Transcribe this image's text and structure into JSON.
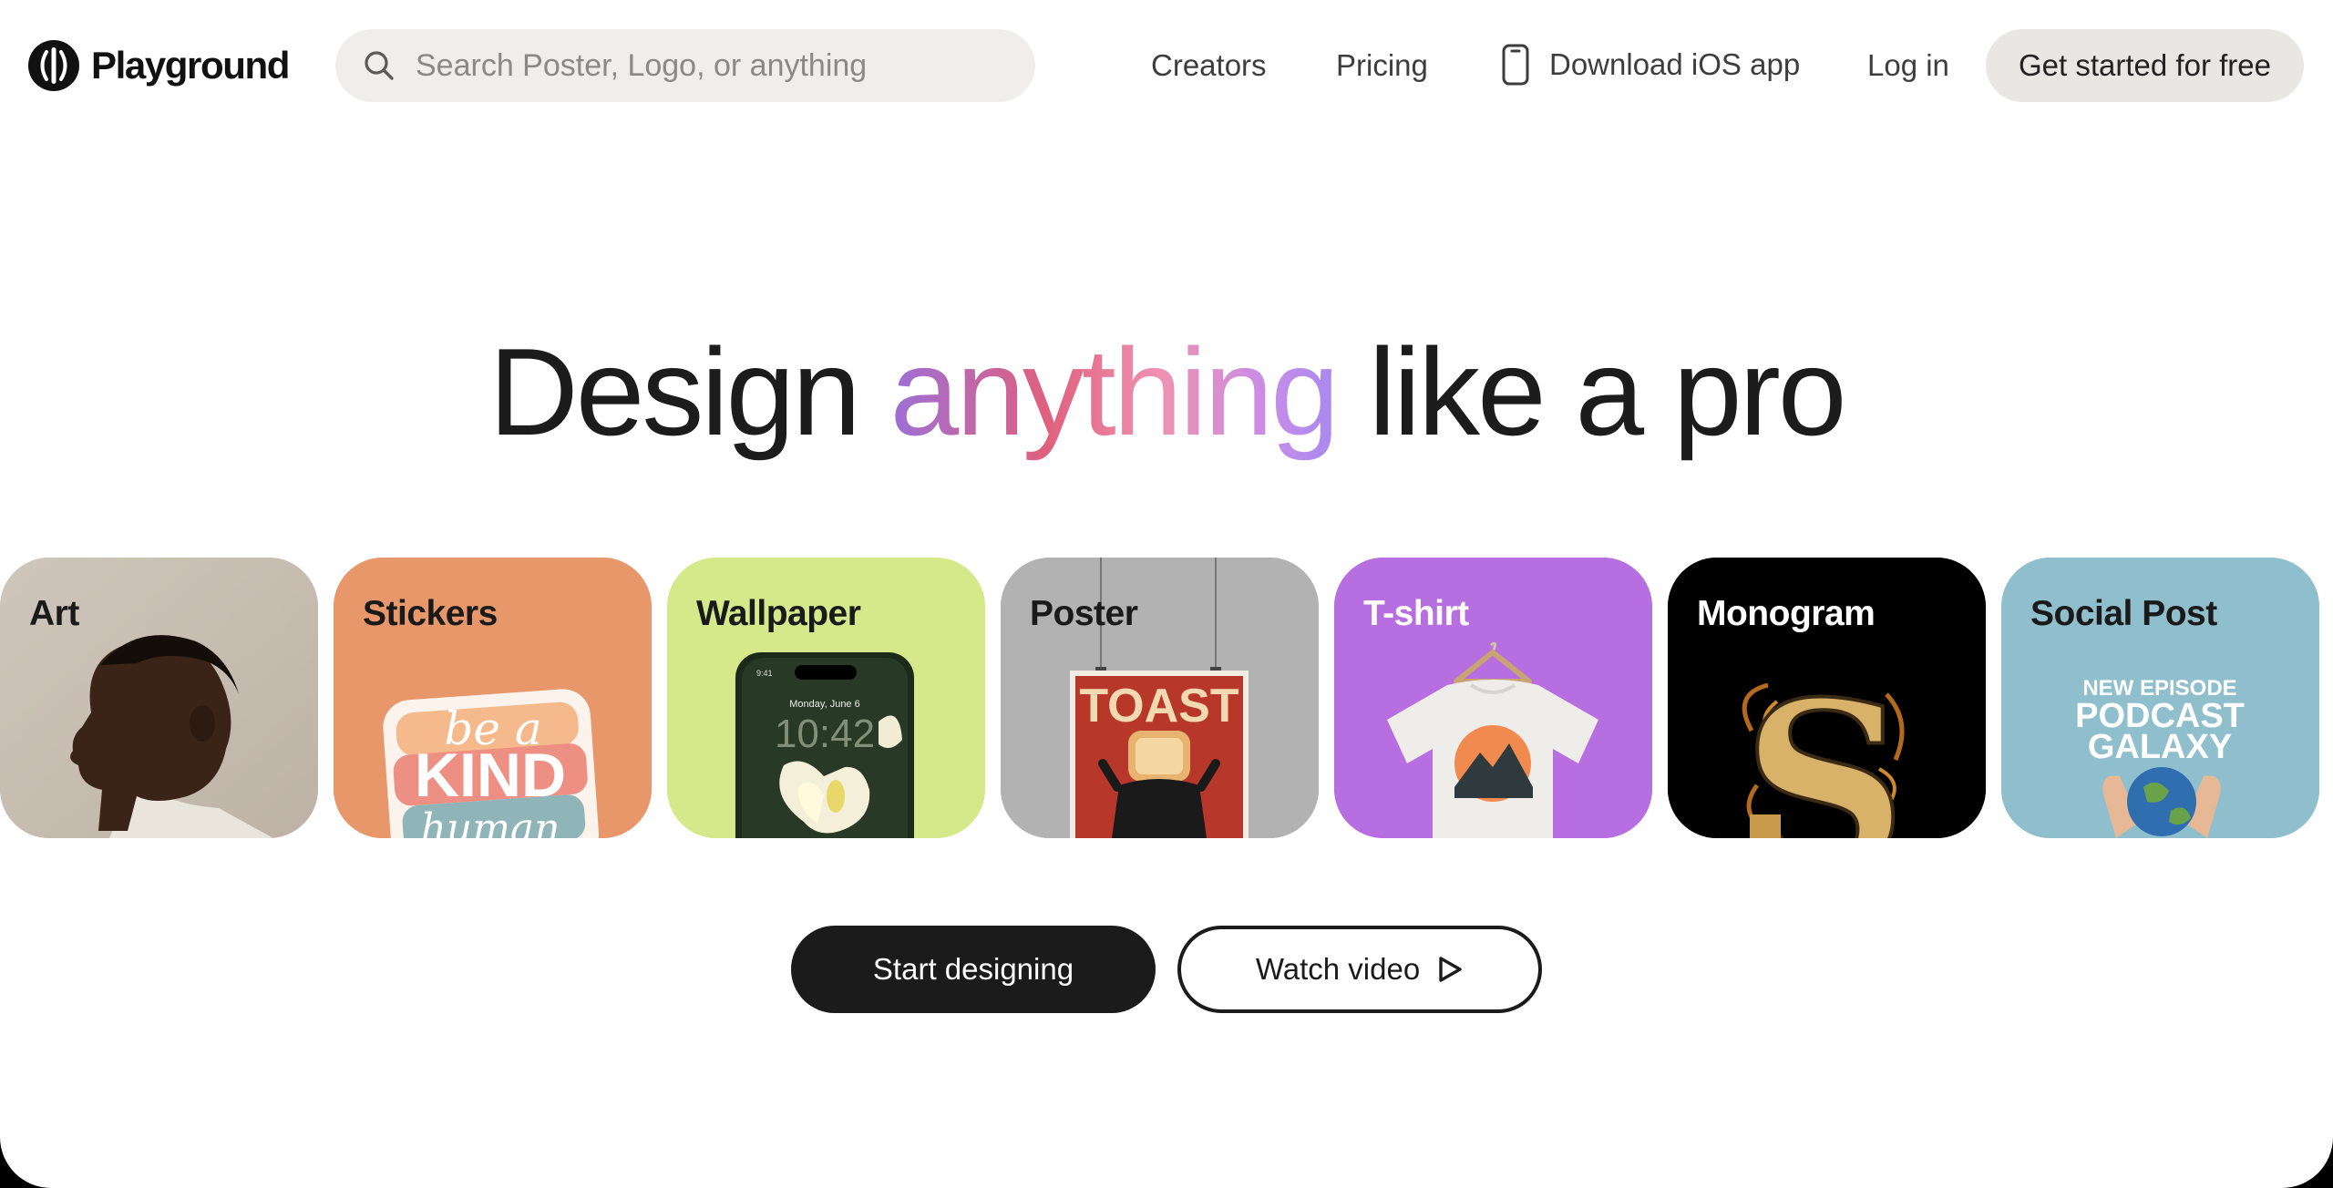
{
  "header": {
    "brand": "Playground",
    "search": {
      "placeholder": "Search Poster, Logo, or anything",
      "value": ""
    },
    "nav": {
      "creators": "Creators",
      "pricing": "Pricing",
      "ios": "Download iOS app",
      "login": "Log in",
      "start_free": "Get started for free"
    },
    "icons": {
      "logo": "playground-logo-icon",
      "search": "search-icon",
      "ios": "phone-icon"
    }
  },
  "hero": {
    "word1": "Design",
    "highlight": "anything",
    "rest": "like a pro",
    "gradient_colors": [
      "#9c6fd8",
      "#e0607d",
      "#ef92b0",
      "#c88ce8",
      "#a68af0"
    ]
  },
  "categories": [
    {
      "label": "Art",
      "bg": "#c9bfb3"
    },
    {
      "label": "Stickers",
      "bg": "#e8976b"
    },
    {
      "label": "Wallpaper",
      "bg": "#d5e88a"
    },
    {
      "label": "Poster",
      "bg": "#b2b2b2"
    },
    {
      "label": "T-shirt",
      "bg": "#b66ee0"
    },
    {
      "label": "Monogram",
      "bg": "#000000"
    },
    {
      "label": "Social Post",
      "bg": "#8fbfcc"
    }
  ],
  "card_art": {
    "sticker_lines": [
      "be a",
      "KIND",
      "human"
    ],
    "wallpaper_time": "10:42",
    "wallpaper_date": "Monday, June 6",
    "wallpaper_status": "9:41",
    "poster_title": "TOAST",
    "monogram_letter": "S",
    "social_lines": [
      "NEW EPISODE",
      "PODCAST",
      "GALAXY"
    ]
  },
  "cta": {
    "primary": "Start designing",
    "secondary": "Watch video",
    "secondary_icon": "play-icon"
  }
}
